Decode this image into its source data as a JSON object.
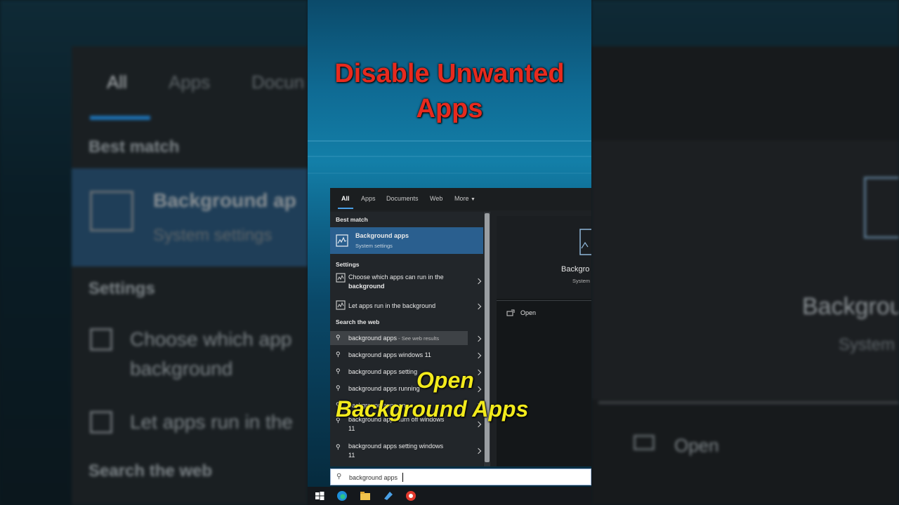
{
  "headline": {
    "line1": "Disable Unwanted",
    "line2": "Apps"
  },
  "overlay": {
    "line1": "Open",
    "line2": "Background Apps"
  },
  "tabs": [
    {
      "label": "All"
    },
    {
      "label": "Apps"
    },
    {
      "label": "Documents"
    },
    {
      "label": "Web"
    },
    {
      "label": "More"
    }
  ],
  "sections": {
    "best_match": "Best match",
    "settings": "Settings",
    "search_web": "Search the web"
  },
  "best_match": {
    "title": "Background apps",
    "subtitle": "System settings"
  },
  "settings_items": [
    {
      "line1": "Choose which apps can run in the",
      "line2": "background"
    },
    {
      "label": "Let apps run in the background"
    }
  ],
  "web_items": [
    {
      "label": "background apps",
      "suffix": " - See web results"
    },
    {
      "label": "background apps windows 11"
    },
    {
      "label": "background apps setting"
    },
    {
      "label": "background apps running"
    },
    {
      "label": "background apps on"
    },
    {
      "line1": "background apps turn off windows",
      "line2": "11"
    },
    {
      "line1": "background apps setting windows",
      "line2": "11"
    }
  ],
  "preview": {
    "title": "Backgro",
    "subtitle": "System",
    "action": "Open"
  },
  "search": {
    "value": "background apps"
  },
  "blur_left": {
    "tabs": [
      "All",
      "Apps",
      "Docun"
    ],
    "best_match": "Best match",
    "title": "Background ap",
    "subtitle": "System settings",
    "settings": "Settings",
    "item1_line1": "Choose which app",
    "item1_line2": "background",
    "item2": "Let apps run in the",
    "search_web": "Search the web"
  },
  "blur_right": {
    "title": "Backgrou",
    "subtitle": "System",
    "action": "Open"
  },
  "colors": {
    "headline": "#e62a1e",
    "overlay": "#f2ea1c",
    "accent": "#2a5f8f"
  }
}
